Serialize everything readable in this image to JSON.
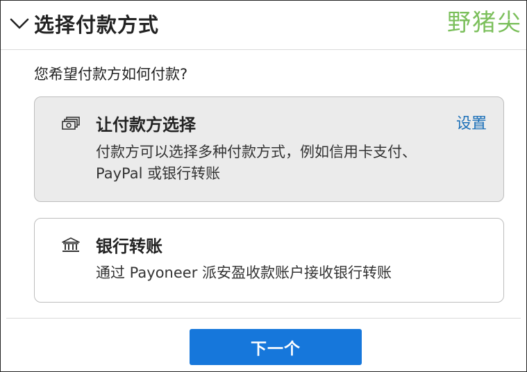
{
  "header": {
    "title": "选择付款方式",
    "chevron_icon": "chevron-down-icon"
  },
  "watermark": "野猪尖",
  "question": "您希望付款方如何付款?",
  "options": [
    {
      "icon": "cash-icon",
      "title": "让付款方选择",
      "description": "付款方可以选择多种付款方式，例如信用卡支付、PayPal 或银行转账",
      "link_label": "设置",
      "selected": true
    },
    {
      "icon": "bank-icon",
      "title": "银行转账",
      "description": "通过 Payoneer 派安盈收款账户接收银行转账",
      "selected": false
    }
  ],
  "footer": {
    "next_label": "下一个"
  },
  "colors": {
    "accent": "#1677db",
    "link": "#1a6fb8",
    "selected_card_bg": "#ebebeb",
    "watermark": "#7bbf5b"
  }
}
